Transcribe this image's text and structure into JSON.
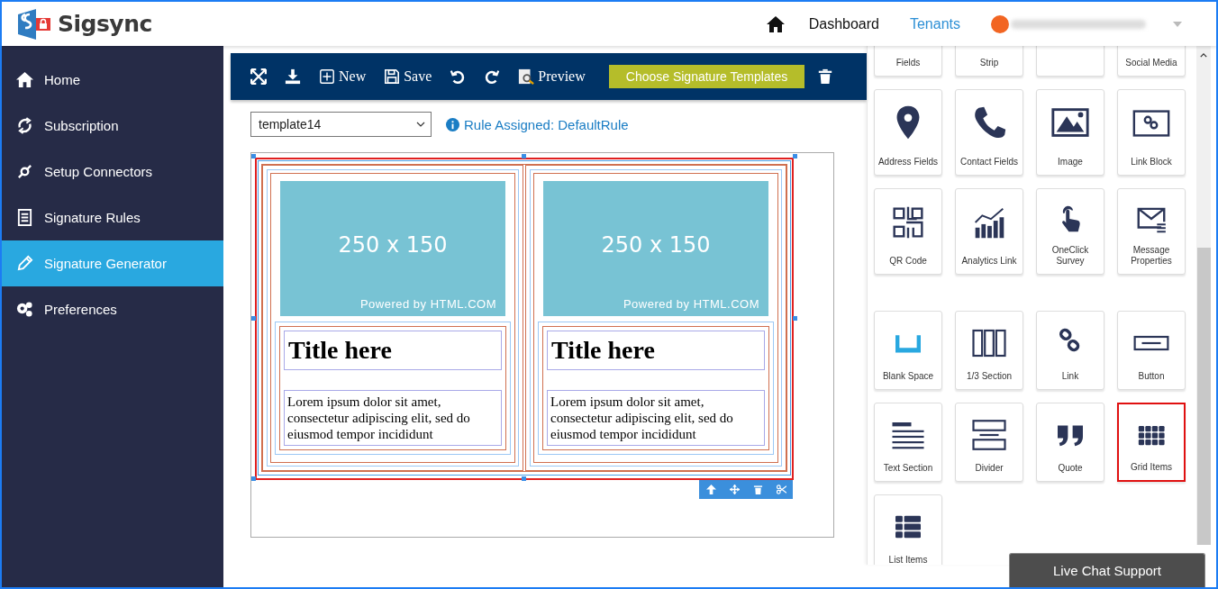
{
  "header": {
    "logo_text": "Sigsync",
    "nav": [
      {
        "label": "Dashboard",
        "selected": false
      },
      {
        "label": "Tenants",
        "selected": true
      }
    ]
  },
  "sidebar": {
    "items": [
      {
        "label": "Home",
        "selected": false
      },
      {
        "label": "Subscription",
        "selected": false
      },
      {
        "label": "Setup Connectors",
        "selected": false
      },
      {
        "label": "Signature Rules",
        "selected": false
      },
      {
        "label": "Signature Generator",
        "selected": true
      },
      {
        "label": "Preferences",
        "selected": false
      }
    ]
  },
  "toolbar": {
    "items": [
      {
        "kind": "expand"
      },
      {
        "kind": "download"
      },
      {
        "kind": "new",
        "label": "New"
      },
      {
        "kind": "save",
        "label": "Save"
      },
      {
        "kind": "undo"
      },
      {
        "kind": "redo"
      },
      {
        "kind": "preview",
        "label": "Preview"
      },
      {
        "kind": "choose",
        "label": "Choose Signature Templates"
      },
      {
        "kind": "trash"
      }
    ]
  },
  "template_select": {
    "value": "template14"
  },
  "rule_info": "Rule Assigned: DefaultRule",
  "template": {
    "columns": [
      {
        "image_size": "250 x 150",
        "image_credit": "Powered by HTML.COM",
        "title": "Title here",
        "body": "Lorem ipsum dolor sit amet, consectetur adipiscing elit, sed do eiusmod tempor incididunt"
      },
      {
        "image_size": "250 x 150",
        "image_credit": "Powered by HTML.COM",
        "title": "Title here",
        "body": "Lorem ipsum dolor sit amet, consectetur adipiscing elit, sed do eiusmod tempor incididunt"
      }
    ]
  },
  "palette": {
    "sections": [
      {
        "rows": [
          [
            {
              "label": "Fields",
              "selected": false
            },
            {
              "label": "Strip",
              "selected": false
            },
            {
              "selected": false
            },
            {
              "label": "Social Media",
              "selected": false
            }
          ],
          [
            {
              "label": "Address Fields",
              "selected": false
            },
            {
              "label": "Contact Fields",
              "selected": false
            },
            {
              "label": "Image",
              "selected": false
            },
            {
              "label": "Link Block",
              "selected": false
            }
          ],
          [
            {
              "label": "QR Code",
              "selected": false
            },
            {
              "label": "Analytics Link",
              "selected": false
            },
            {
              "label": "OneClick Survey",
              "selected": false
            },
            {
              "label": "Message Properties",
              "selected": false
            }
          ]
        ]
      },
      {
        "rows": [
          [
            {
              "label": "Blank Space",
              "selected": false
            },
            {
              "label": "1/3 Section",
              "selected": false
            },
            {
              "label": "Link",
              "selected": false
            },
            {
              "label": "Button",
              "selected": false
            }
          ],
          [
            {
              "label": "Text Section",
              "selected": false
            },
            {
              "label": "Divider",
              "selected": false
            },
            {
              "label": "Quote",
              "selected": false
            },
            {
              "label": "Grid Items",
              "selected": true
            }
          ],
          [
            {
              "label": "List Items",
              "selected": false
            }
          ]
        ]
      }
    ]
  },
  "chat_button": "Live Chat Support"
}
